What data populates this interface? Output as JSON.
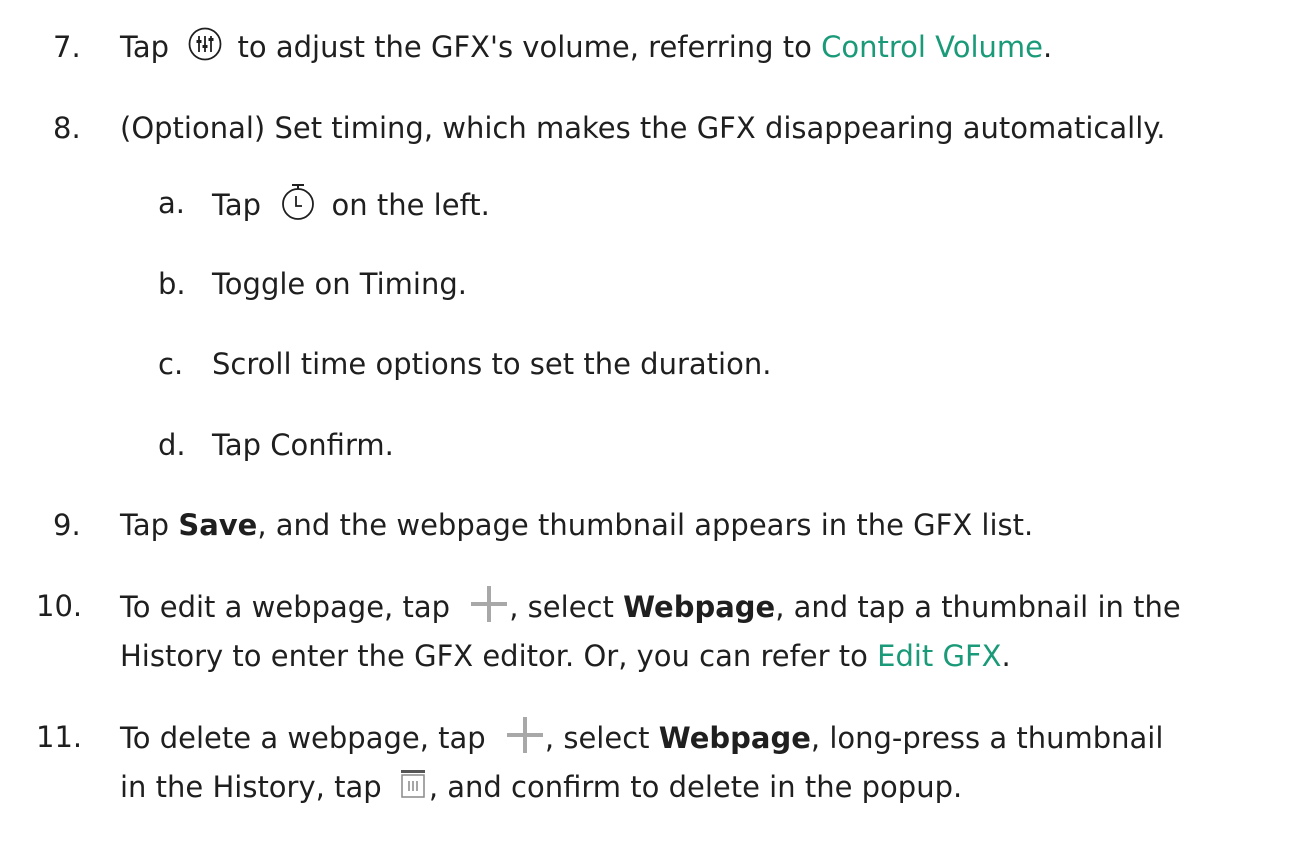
{
  "steps": [
    {
      "num": "7.",
      "before": "Tap",
      "icon": "mixer-icon",
      "after": " to adjust the GFX's volume, referring to ",
      "link": "Control Volume",
      "end": "."
    },
    {
      "num": "8.",
      "text": "(Optional) Set timing, which makes the GFX disappearing automatically."
    },
    {
      "num": "9.",
      "before": "Tap ",
      "bold": "Save",
      "after": ", and the webpage thumbnail appears in the GFX list."
    },
    {
      "num": "10.",
      "l1_a": "To edit a webpage, tap ",
      "icon": "plus-icon",
      "l1_b": ", select ",
      "l1_bold": "Webpage",
      "l1_c": ", and tap a thumbnail in the",
      "l2_a": "History to enter the GFX editor. Or, you can refer to ",
      "l2_link": "Edit GFX",
      "l2_end": "."
    },
    {
      "num": "11.",
      "l1_a": "To delete a webpage, tap ",
      "icon": "plus-icon",
      "l1_b": ", select ",
      "l1_bold": "Webpage",
      "l1_c": ", long-press a thumbnail",
      "l2_a": "in the History, tap ",
      "l2_icon": "trash-icon",
      "l2_b": ", and confirm to delete in the popup."
    }
  ],
  "substeps": [
    {
      "letter": "a.",
      "before": "Tap",
      "icon": "timer-icon",
      "after": " on the left."
    },
    {
      "letter": "b.",
      "text": "Toggle on Timing."
    },
    {
      "letter": "c.",
      "text": "Scroll time options to set the duration."
    },
    {
      "letter": "d.",
      "text": "Tap Confirm."
    }
  ],
  "colors": {
    "text": "#1f1f1f",
    "link": "#1a9a78",
    "icon": "#888888"
  }
}
